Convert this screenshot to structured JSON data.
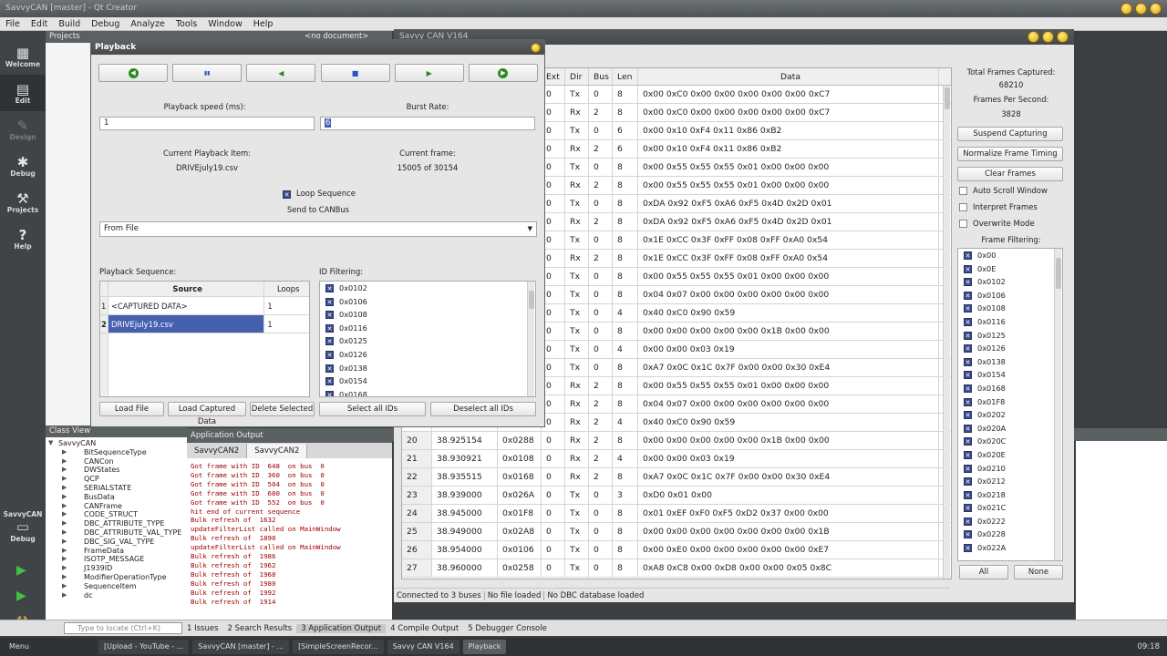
{
  "qtcreator": {
    "title": "SavvyCAN [master] - Qt Creator",
    "menu": [
      "File",
      "Edit",
      "Build",
      "Debug",
      "Analyze",
      "Tools",
      "Window",
      "Help"
    ],
    "modes": [
      {
        "label": "Welcome",
        "icon": "▦"
      },
      {
        "label": "Edit",
        "icon": "▤"
      },
      {
        "label": "Design",
        "icon": "✎"
      },
      {
        "label": "Debug",
        "icon": "✱"
      },
      {
        "label": "Projects",
        "icon": "⚒"
      },
      {
        "label": "Help",
        "icon": "?"
      }
    ],
    "kit_label": "SavvyCAN",
    "kit_mode": "Debug",
    "projects_header": "Projects",
    "no_document": "<no document>",
    "class_view_header": "Class View",
    "class_items": [
      {
        "name": "SavvyCAN",
        "open": true
      },
      {
        "name": "BitSequenceType"
      },
      {
        "name": "CANCon"
      },
      {
        "name": "DWStates"
      },
      {
        "name": "QCP"
      },
      {
        "name": "SERIALSTATE"
      },
      {
        "name": "BusData"
      },
      {
        "name": "CANFrame"
      },
      {
        "name": "CODE_STRUCT"
      },
      {
        "name": "DBC_ATTRIBUTE_TYPE"
      },
      {
        "name": "DBC_ATTRIBUTE_VAL_TYPE"
      },
      {
        "name": "DBC_SIG_VAL_TYPE"
      },
      {
        "name": "FrameData"
      },
      {
        "name": "ISOTP_MESSAGE"
      },
      {
        "name": "J1939ID"
      },
      {
        "name": "ModifierOperationType"
      },
      {
        "name": "SequenceItem"
      },
      {
        "name": "dc"
      }
    ],
    "app_output_header": "Application Output",
    "output_tabs": [
      "SavvyCAN2",
      "SavvyCAN2"
    ],
    "log_lines": [
      "Got frame with ID  648  on bus  0",
      "Got frame with ID  360  on bus  0",
      "Got frame with ID  504  on bus  0",
      "Got frame with ID  680  on bus  0",
      "Got frame with ID  552  on bus  0",
      "hit end of current sequence",
      "Bulk refresh of  1632",
      "updateFilterList called on MainWindow",
      "Bulk refresh of  1890",
      "updateFilterList called on MainWindow",
      "Bulk refresh of  1986",
      "Bulk refresh of  1962",
      "Bulk refresh of  1968",
      "Bulk refresh of  1980",
      "Bulk refresh of  1992",
      "Bulk refresh of  1914"
    ],
    "locate_placeholder": "Type to locate (Ctrl+K)",
    "bottom_tabs": [
      "1 Issues",
      "2 Search Results",
      "3 Application Output",
      "4 Compile Output",
      "5 Debugger Console"
    ]
  },
  "taskbar": {
    "menu": "Menu",
    "items": [
      "[Upload - YouTube - ...",
      "SavvyCAN [master] - ...",
      "[SimpleScreenRecor...",
      "Savvy CAN V164",
      "Playback"
    ],
    "clock": "09:18"
  },
  "savvycan": {
    "title": "Savvy CAN V164",
    "columns": [
      "",
      "",
      "",
      "Ext",
      "Dir",
      "Bus",
      "Len",
      "Data"
    ],
    "rows": [
      {
        "n": "",
        "time": "",
        "id": "",
        "ext": "0",
        "dir": "Tx",
        "bus": "0",
        "len": "8",
        "data": "0x00 0xC0 0x00 0x00 0x00 0x00 0x00 0xC7"
      },
      {
        "n": "",
        "time": "",
        "id": "",
        "ext": "0",
        "dir": "Rx",
        "bus": "2",
        "len": "8",
        "data": "0x00 0xC0 0x00 0x00 0x00 0x00 0x00 0xC7"
      },
      {
        "n": "",
        "time": "",
        "id": "",
        "ext": "0",
        "dir": "Tx",
        "bus": "0",
        "len": "6",
        "data": "0x00 0x10 0xF4 0x11 0x86 0xB2"
      },
      {
        "n": "",
        "time": "",
        "id": "",
        "ext": "0",
        "dir": "Rx",
        "bus": "2",
        "len": "6",
        "data": "0x00 0x10 0xF4 0x11 0x86 0xB2"
      },
      {
        "n": "",
        "time": "",
        "id": "",
        "ext": "0",
        "dir": "Tx",
        "bus": "0",
        "len": "8",
        "data": "0x00 0x55 0x55 0x55 0x01 0x00 0x00 0x00"
      },
      {
        "n": "",
        "time": "",
        "id": "",
        "ext": "0",
        "dir": "Rx",
        "bus": "2",
        "len": "8",
        "data": "0x00 0x55 0x55 0x55 0x01 0x00 0x00 0x00"
      },
      {
        "n": "",
        "time": "",
        "id": "",
        "ext": "0",
        "dir": "Tx",
        "bus": "0",
        "len": "8",
        "data": "0xDA 0x92 0xF5 0xA6 0xF5 0x4D 0x2D 0x01"
      },
      {
        "n": "",
        "time": "",
        "id": "",
        "ext": "0",
        "dir": "Rx",
        "bus": "2",
        "len": "8",
        "data": "0xDA 0x92 0xF5 0xA6 0xF5 0x4D 0x2D 0x01"
      },
      {
        "n": "",
        "time": "",
        "id": "",
        "ext": "0",
        "dir": "Tx",
        "bus": "0",
        "len": "8",
        "data": "0x1E 0xCC 0x3F 0xFF 0x08 0xFF 0xA0 0x54"
      },
      {
        "n": "",
        "time": "",
        "id": "",
        "ext": "0",
        "dir": "Rx",
        "bus": "2",
        "len": "8",
        "data": "0x1E 0xCC 0x3F 0xFF 0x08 0xFF 0xA0 0x54"
      },
      {
        "n": "",
        "time": "",
        "id": "",
        "ext": "0",
        "dir": "Tx",
        "bus": "0",
        "len": "8",
        "data": "0x00 0x55 0x55 0x55 0x01 0x00 0x00 0x00"
      },
      {
        "n": "",
        "time": "",
        "id": "",
        "ext": "0",
        "dir": "Tx",
        "bus": "0",
        "len": "8",
        "data": "0x04 0x07 0x00 0x00 0x00 0x00 0x00 0x00"
      },
      {
        "n": "",
        "time": "",
        "id": "",
        "ext": "0",
        "dir": "Tx",
        "bus": "0",
        "len": "4",
        "data": "0x40 0xC0 0x90 0x59"
      },
      {
        "n": "",
        "time": "",
        "id": "",
        "ext": "0",
        "dir": "Tx",
        "bus": "0",
        "len": "8",
        "data": "0x00 0x00 0x00 0x00 0x00 0x1B 0x00 0x00"
      },
      {
        "n": "",
        "time": "",
        "id": "",
        "ext": "0",
        "dir": "Tx",
        "bus": "0",
        "len": "4",
        "data": "0x00 0x00 0x03 0x19"
      },
      {
        "n": "",
        "time": "",
        "id": "",
        "ext": "0",
        "dir": "Tx",
        "bus": "0",
        "len": "8",
        "data": "0xA7 0x0C 0x1C 0x7F 0x00 0x00 0x30 0xE4"
      },
      {
        "n": "",
        "time": "",
        "id": "",
        "ext": "0",
        "dir": "Rx",
        "bus": "2",
        "len": "8",
        "data": "0x00 0x55 0x55 0x55 0x01 0x00 0x00 0x00"
      },
      {
        "n": "",
        "time": "",
        "id": "",
        "ext": "0",
        "dir": "Rx",
        "bus": "2",
        "len": "8",
        "data": "0x04 0x07 0x00 0x00 0x00 0x00 0x00 0x00"
      },
      {
        "n": "",
        "time": "",
        "id": "",
        "ext": "0",
        "dir": "Rx",
        "bus": "2",
        "len": "4",
        "data": "0x40 0xC0 0x90 0x59"
      },
      {
        "n": "20",
        "time": "38.925154",
        "id": "0x0288",
        "ext": "0",
        "dir": "Rx",
        "bus": "2",
        "len": "8",
        "data": "0x00 0x00 0x00 0x00 0x00 0x1B 0x00 0x00"
      },
      {
        "n": "21",
        "time": "38.930921",
        "id": "0x0108",
        "ext": "0",
        "dir": "Rx",
        "bus": "2",
        "len": "4",
        "data": "0x00 0x00 0x03 0x19"
      },
      {
        "n": "22",
        "time": "38.935515",
        "id": "0x0168",
        "ext": "0",
        "dir": "Rx",
        "bus": "2",
        "len": "8",
        "data": "0xA7 0x0C 0x1C 0x7F 0x00 0x00 0x30 0xE4"
      },
      {
        "n": "23",
        "time": "38.939000",
        "id": "0x026A",
        "ext": "0",
        "dir": "Tx",
        "bus": "0",
        "len": "3",
        "data": "0xD0 0x01 0x00"
      },
      {
        "n": "24",
        "time": "38.945000",
        "id": "0x01F8",
        "ext": "0",
        "dir": "Tx",
        "bus": "0",
        "len": "8",
        "data": "0x01 0xEF 0xF0 0xF5 0xD2 0x37 0x00 0x00"
      },
      {
        "n": "25",
        "time": "38.949000",
        "id": "0x02A8",
        "ext": "0",
        "dir": "Tx",
        "bus": "0",
        "len": "8",
        "data": "0x00 0x00 0x00 0x00 0x00 0x00 0x00 0x1B"
      },
      {
        "n": "26",
        "time": "38.954000",
        "id": "0x0106",
        "ext": "0",
        "dir": "Tx",
        "bus": "0",
        "len": "8",
        "data": "0x00 0xE0 0x00 0x00 0x00 0x00 0x00 0xE7"
      },
      {
        "n": "27",
        "time": "38.960000",
        "id": "0x0258",
        "ext": "0",
        "dir": "Tx",
        "bus": "0",
        "len": "8",
        "data": "0xA8 0xC8 0x00 0xD8 0x00 0x00 0x05 0x8C"
      }
    ],
    "total_frames_label": "Total Frames Captured:",
    "total_frames": "68210",
    "fps_label": "Frames Per Second:",
    "fps": "3828",
    "btn_suspend": "Suspend Capturing",
    "btn_normalize": "Normalize Frame Timing",
    "btn_clear": "Clear Frames",
    "opt_autoscroll": "Auto Scroll Window",
    "opt_interpret": "Interpret Frames",
    "opt_overwrite": "Overwrite Mode",
    "frame_filter_label": "Frame Filtering:",
    "frame_filter_ids": [
      "0x00",
      "0x0E",
      "0x0102",
      "0x0106",
      "0x0108",
      "0x0116",
      "0x0125",
      "0x0126",
      "0x0138",
      "0x0154",
      "0x0168",
      "0x01F8",
      "0x0202",
      "0x020A",
      "0x020C",
      "0x020E",
      "0x0210",
      "0x0212",
      "0x0218",
      "0x021C",
      "0x0222",
      "0x0228",
      "0x022A"
    ],
    "btn_all": "All",
    "btn_none": "None",
    "status": [
      "Connected to 3 buses",
      "No file loaded",
      "No DBC database loaded"
    ]
  },
  "playback": {
    "title": "Playback",
    "controls": [
      {
        "name": "rewind",
        "glyph": "◀",
        "color": "#2b8a1f"
      },
      {
        "name": "pause",
        "glyph": "▮▮",
        "color": "#2a54c8"
      },
      {
        "name": "step-back",
        "glyph": "◀",
        "color": "#2b8a1f"
      },
      {
        "name": "stop",
        "glyph": "■",
        "color": "#2a54c8"
      },
      {
        "name": "play",
        "glyph": "▶",
        "color": "#2b8a1f"
      },
      {
        "name": "fast-forward",
        "glyph": "▶",
        "color": "#2b8a1f"
      }
    ],
    "speed_label": "Playback speed (ms):",
    "speed_value": "1",
    "burst_label": "Burst Rate:",
    "burst_value": "6",
    "current_item_label": "Current Playback Item:",
    "current_item": "DRIVEjuly19.csv",
    "current_frame_label": "Current frame:",
    "current_frame": "15005 of 30154",
    "loop_label": "Loop Sequence",
    "send_label": "Send to CANBus",
    "send_target": "From File",
    "sequence_label": "Playback Sequence:",
    "seq_headers": [
      "Source",
      "Loops"
    ],
    "sequence": [
      {
        "n": "1",
        "source": "<CAPTURED DATA>",
        "loops": "1"
      },
      {
        "n": "2",
        "source": "DRIVEjuly19.csv",
        "loops": "1"
      }
    ],
    "id_filter_label": "ID Filtering:",
    "id_filters": [
      "0x0102",
      "0x0106",
      "0x0108",
      "0x0116",
      "0x0125",
      "0x0126",
      "0x0138",
      "0x0154",
      "0x0168"
    ],
    "btn_load_file": "Load File",
    "btn_load_captured": "Load Captured Data",
    "btn_delete": "Delete Selected",
    "btn_select_all": "Select all IDs",
    "btn_deselect_all": "Deselect all IDs",
    "selection_color": "#4660b0"
  }
}
